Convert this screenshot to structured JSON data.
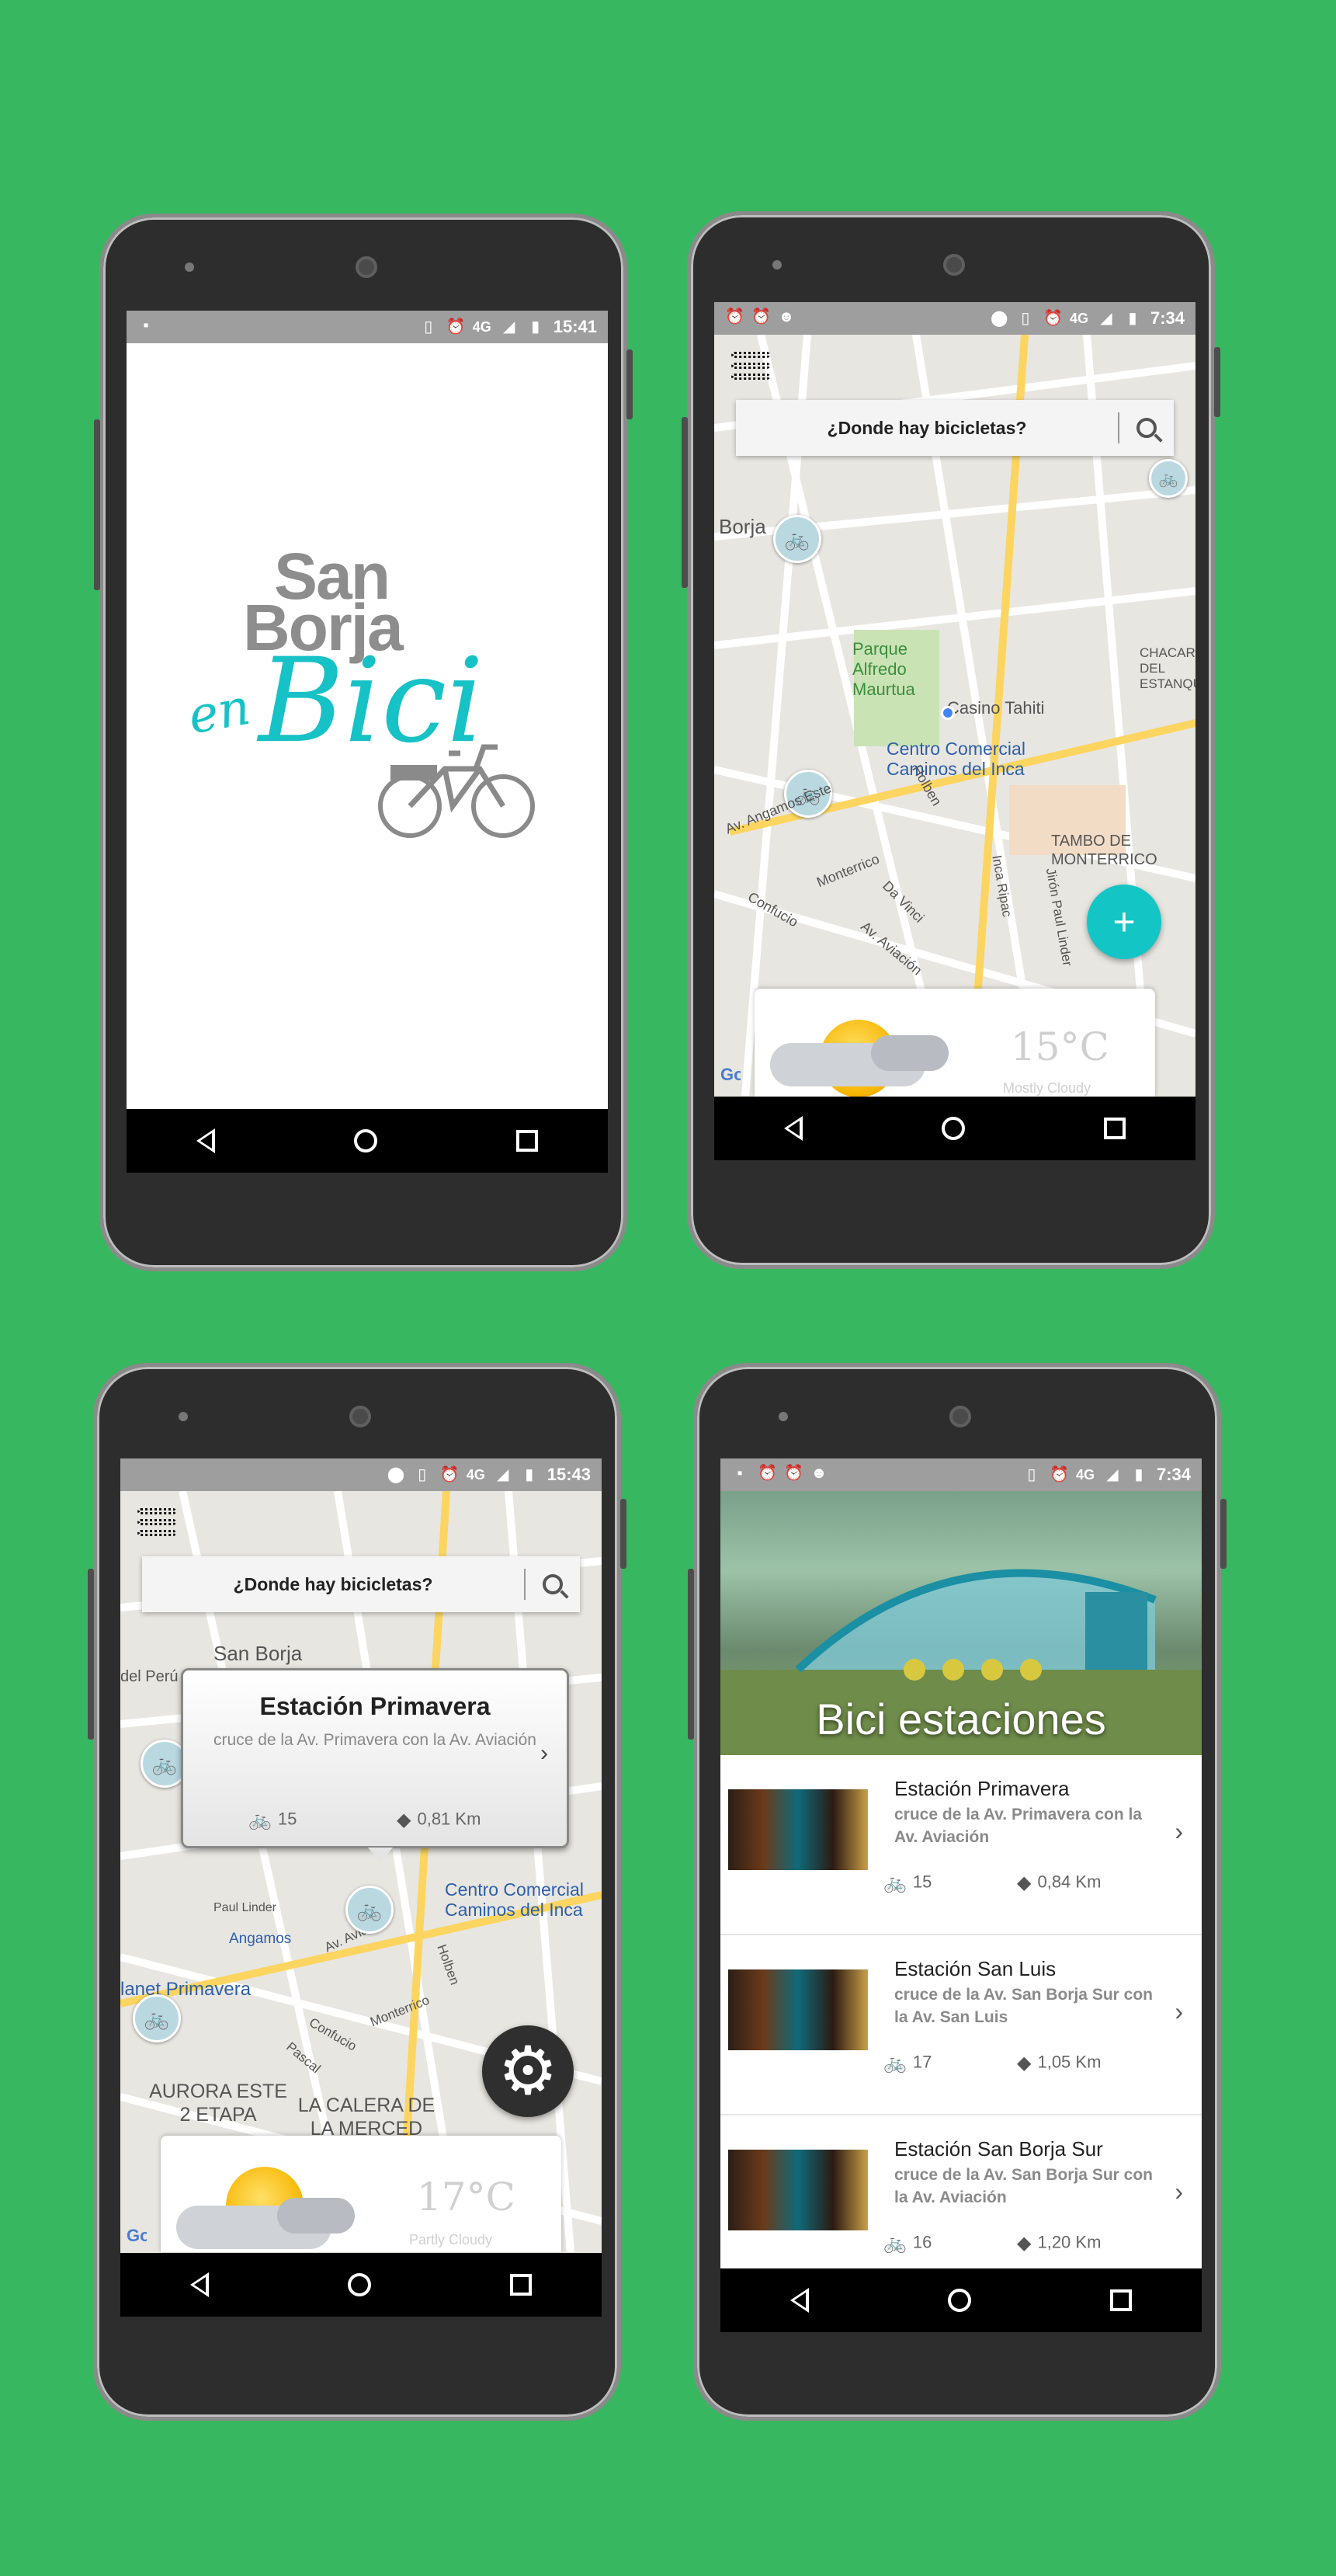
{
  "colors": {
    "background": "#37b760",
    "accent": "#14c5c5",
    "status_bar": "#9e9e9e"
  },
  "splash": {
    "status_time": "15:41",
    "status_network": "4G",
    "logo_line1": "San",
    "logo_line2": "Borja",
    "logo_script_en": "en",
    "logo_script_bici": "Bici"
  },
  "map_screen": {
    "status_time": "7:34",
    "status_network": "4G",
    "search_placeholder": "¿Donde hay bicicletas?",
    "fab_label": "+",
    "labels": [
      "Borja",
      "Parque Alfredo Maurtua",
      "Casino Tahiti",
      "Centro Comercial Caminos del Inca",
      "TAMBO DE MONTERRICO",
      "CHACARILLA DEL ESTANQUE",
      "Av. Angamos Este",
      "Av. Aviación",
      "Monterrico",
      "Confucio",
      "Da Vinci",
      "Inca Ripac",
      "Jirón Paul Linder",
      "Holben"
    ],
    "weather_temp": "15°C",
    "weather_cond": "Mostly Cloudy",
    "map_attribution": "Google"
  },
  "station_map": {
    "status_time": "15:43",
    "status_network": "4G",
    "search_placeholder": "¿Donde hay bicicletas?",
    "popup": {
      "title": "Estación Primavera",
      "subtitle": "cruce de la Av. Primavera con la Av. Aviación",
      "bikes": "15",
      "distance": "0,81 Km"
    },
    "labels": [
      "San Borja",
      "del Perú",
      "Centro Comercial Caminos del Inca",
      "Angamos",
      "lanet Primavera",
      "AURORA ESTE 2 ETAPA",
      "LA CALERA DE LA MERCED",
      "Av. Aviación",
      "Monterrico",
      "Confucio",
      "Paul Linder",
      "Holben",
      "Pascal"
    ],
    "weather_temp": "17°C",
    "weather_cond": "Partly Cloudy",
    "map_attribution": "Google"
  },
  "stations_list": {
    "status_time": "7:34",
    "status_network": "4G",
    "header_title": "Bici estaciones",
    "items": [
      {
        "name": "Estación Primavera",
        "address": "cruce de la Av. Primavera con la Av. Aviación",
        "bikes": "15",
        "distance": "0,84 Km"
      },
      {
        "name": "Estación San Luis",
        "address": "cruce de la Av. San Borja Sur con la Av. San Luis",
        "bikes": "17",
        "distance": "1,05 Km"
      },
      {
        "name": "Estación San Borja Sur",
        "address": "cruce de la Av. San Borja Sur con la Av. Aviación",
        "bikes": "16",
        "distance": "1,20 Km"
      }
    ]
  }
}
